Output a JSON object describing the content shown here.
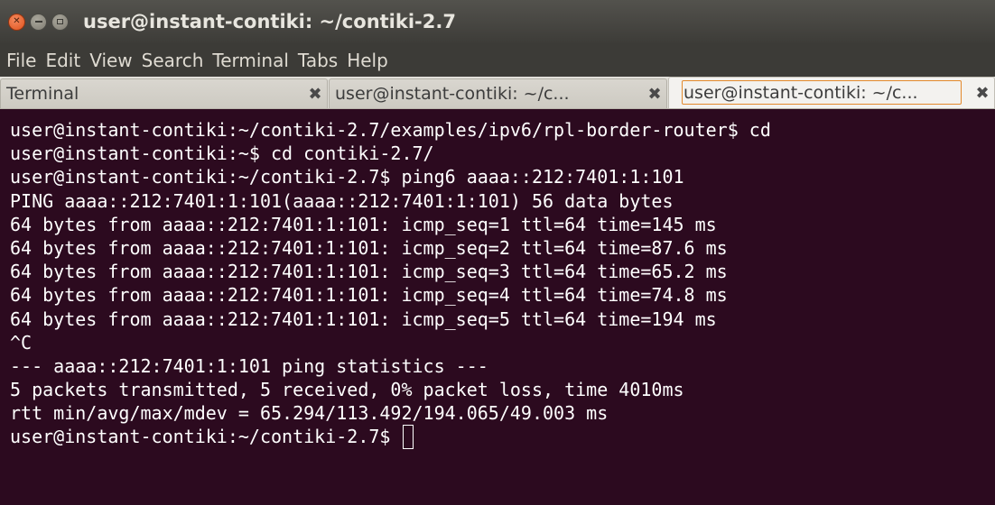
{
  "window": {
    "title": "user@instant-contiki: ~/contiki-2.7",
    "close_glyph": "✕",
    "accent_close_color": "#e0531d"
  },
  "menu": [
    "File",
    "Edit",
    "View",
    "Search",
    "Terminal",
    "Tabs",
    "Help"
  ],
  "tabs": [
    {
      "label": "Terminal",
      "close": "✖",
      "active": false
    },
    {
      "label": "user@instant-contiki: ~/c...",
      "close": "✖",
      "active": false
    },
    {
      "label": "user@instant-contiki: ~/c...",
      "close": "✖",
      "active": true
    }
  ],
  "terminal": {
    "background": "#2c0a1f",
    "lines": [
      "user@instant-contiki:~/contiki-2.7/examples/ipv6/rpl-border-router$ cd",
      "user@instant-contiki:~$ cd contiki-2.7/",
      "user@instant-contiki:~/contiki-2.7$ ping6 aaaa::212:7401:1:101",
      "PING aaaa::212:7401:1:101(aaaa::212:7401:1:101) 56 data bytes",
      "64 bytes from aaaa::212:7401:1:101: icmp_seq=1 ttl=64 time=145 ms",
      "64 bytes from aaaa::212:7401:1:101: icmp_seq=2 ttl=64 time=87.6 ms",
      "64 bytes from aaaa::212:7401:1:101: icmp_seq=3 ttl=64 time=65.2 ms",
      "64 bytes from aaaa::212:7401:1:101: icmp_seq=4 ttl=64 time=74.8 ms",
      "64 bytes from aaaa::212:7401:1:101: icmp_seq=5 ttl=64 time=194 ms",
      "^C",
      "--- aaaa::212:7401:1:101 ping statistics ---",
      "5 packets transmitted, 5 received, 0% packet loss, time 4010ms",
      "rtt min/avg/max/mdev = 65.294/113.492/194.065/49.003 ms"
    ],
    "prompt": "user@instant-contiki:~/contiki-2.7$ "
  }
}
